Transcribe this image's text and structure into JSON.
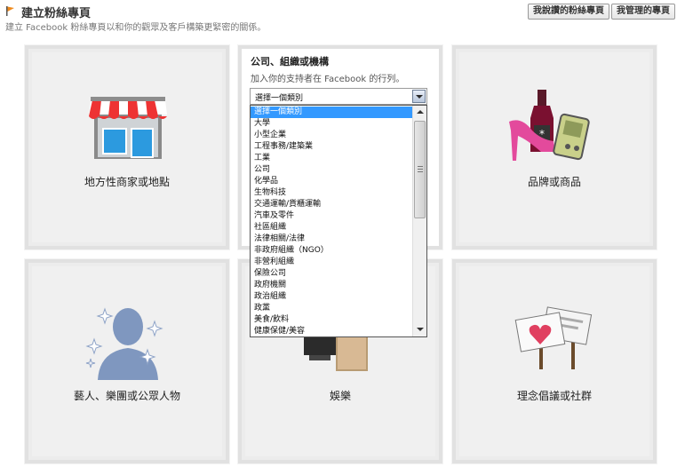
{
  "header": {
    "title": "建立粉絲專頁",
    "subtitle": "建立 Facebook 粉絲專頁以和你的觀眾及客戶構築更緊密的關係。",
    "btn_liked": "我說讚的粉絲專頁",
    "btn_managed": "我管理的專頁"
  },
  "tiles": {
    "local": "地方性商家或地點",
    "brand": "品牌或商品",
    "artist": "藝人、樂團或公眾人物",
    "entertainment": "娛樂",
    "cause": "理念倡議或社群"
  },
  "company": {
    "title": "公司、組織或機構",
    "desc": "加入你的支持者在 Facebook 的行列。",
    "select_value": "選擇一個類別",
    "options": [
      "選擇一個類別",
      "大學",
      "小型企業",
      "工程事務/建築業",
      "工業",
      "公司",
      "化學品",
      "生物科技",
      "交通運輸/貨櫃運輸",
      "汽車及零件",
      "社區組織",
      "法律相關/法律",
      "非政府組織（NGO）",
      "非營利組織",
      "保險公司",
      "政府機關",
      "政治組織",
      "政黨",
      "美食/飲料",
      "健康保健/美容"
    ]
  },
  "colors": {
    "selection": "#3399ff",
    "tile_bg": "#f0f0f0"
  }
}
